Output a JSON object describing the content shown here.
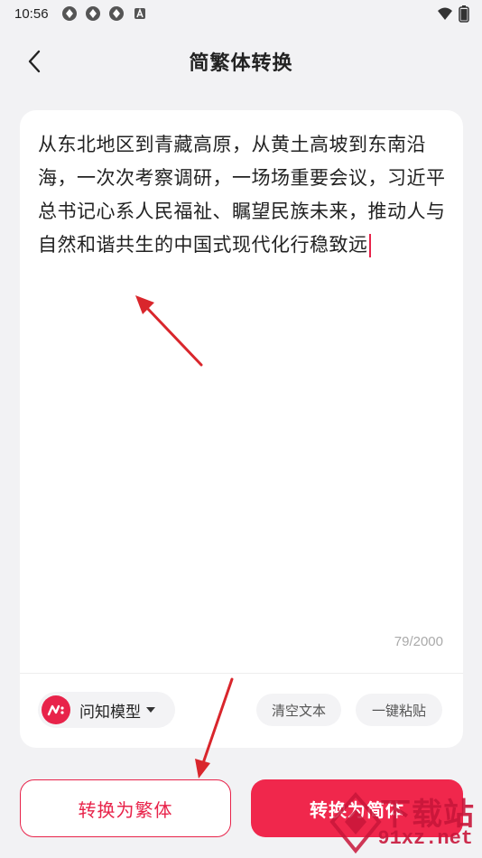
{
  "status_bar": {
    "time": "10:56",
    "icons": [
      "sync-icon",
      "sync-icon",
      "sync-icon",
      "a-box-icon"
    ],
    "right_icons": [
      "wifi-icon",
      "battery-icon"
    ]
  },
  "header": {
    "title": "简繁体转换",
    "back_icon": "chevron-left-icon"
  },
  "editor": {
    "text": "从东北地区到青藏高原，从黄土高坡到东南沿海，一次次考察调研，一场场重要会议，习近平总书记心系人民福祉、瞩望民族未来，推动人与自然和谐共生的中国式现代化行稳致远",
    "counter": "79/2000"
  },
  "toolbar": {
    "model_label": "问知模型",
    "clear_label": "清空文本",
    "paste_label": "一键粘贴"
  },
  "actions": {
    "to_traditional_label": "转换为繁体",
    "to_simplified_label": "转换为简体"
  },
  "watermark": {
    "line1": "下载站",
    "line2": "91xz.net"
  },
  "colors": {
    "accent": "#f0274c",
    "background": "#f2f2f4",
    "card": "#ffffff",
    "annotation_arrow": "#d9262c"
  }
}
